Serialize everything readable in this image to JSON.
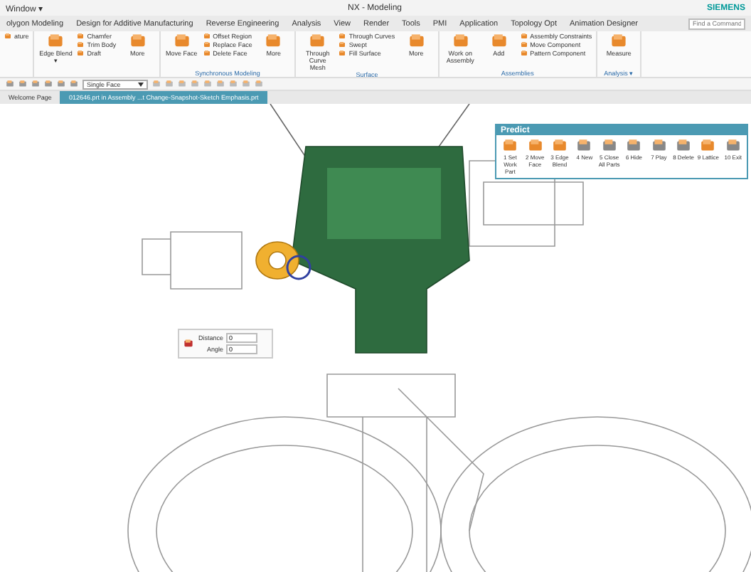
{
  "window": {
    "menu": "Window ▾",
    "title": "NX - Modeling",
    "brand": "SIEMENS"
  },
  "tabs": [
    {
      "label": "olygon Modeling",
      "selected": false
    },
    {
      "label": "Design for Additive Manufacturing",
      "selected": false
    },
    {
      "label": "Reverse Engineering",
      "selected": false
    },
    {
      "label": "Analysis",
      "selected": false
    },
    {
      "label": "View",
      "selected": false
    },
    {
      "label": "Render",
      "selected": false
    },
    {
      "label": "Tools",
      "selected": false
    },
    {
      "label": "PMI",
      "selected": false
    },
    {
      "label": "Application",
      "selected": false
    },
    {
      "label": "Topology Opt",
      "selected": false
    },
    {
      "label": "Animation Designer",
      "selected": false
    }
  ],
  "search": {
    "placeholder": "Find a Command"
  },
  "ribbon": [
    {
      "items": [
        {
          "kind": "small",
          "label": "ature"
        }
      ]
    },
    {
      "items": [
        {
          "kind": "large",
          "label": "Edge Blend ▾"
        },
        {
          "kind": "small",
          "label": "Chamfer"
        },
        {
          "kind": "small",
          "label": "Trim Body"
        },
        {
          "kind": "small",
          "label": "Draft"
        },
        {
          "kind": "large",
          "label": "More"
        }
      ]
    },
    {
      "label": "Synchronous Modeling",
      "items": [
        {
          "kind": "large",
          "label": "Move Face"
        },
        {
          "kind": "small",
          "label": "Offset Region"
        },
        {
          "kind": "small",
          "label": "Replace Face"
        },
        {
          "kind": "small",
          "label": "Delete Face"
        },
        {
          "kind": "large",
          "label": "More"
        }
      ]
    },
    {
      "label": "Surface",
      "items": [
        {
          "kind": "large",
          "label": "Through Curve Mesh"
        },
        {
          "kind": "small",
          "label": "Through Curves"
        },
        {
          "kind": "small",
          "label": "Swept"
        },
        {
          "kind": "small",
          "label": "Fill Surface"
        },
        {
          "kind": "large",
          "label": "More"
        }
      ]
    },
    {
      "label": "Assemblies",
      "items": [
        {
          "kind": "large",
          "label": "Work on Assembly"
        },
        {
          "kind": "large",
          "label": "Add"
        },
        {
          "kind": "small",
          "label": "Assembly Constraints"
        },
        {
          "kind": "small",
          "label": "Move Component"
        },
        {
          "kind": "small",
          "label": "Pattern Component"
        }
      ]
    },
    {
      "label": "Analysis ▾",
      "items": [
        {
          "kind": "large",
          "label": "Measure"
        }
      ]
    }
  ],
  "filter": {
    "value": "Single Face"
  },
  "documents": [
    {
      "label": "Welcome Page",
      "selected": false
    },
    {
      "label": "012646.prt in Assembly ...t Change-Snapshot-Sketch Emphasis.prt",
      "selected": true
    }
  ],
  "predict": {
    "title": "Predict",
    "items": [
      "1 Set Work Part",
      "2 Move Face",
      "3 Edge Blend",
      "4 New",
      "5 Close All Parts",
      "6 Hide",
      "7 Play",
      "8 Delete",
      "9 Lattice",
      "10 Exit"
    ]
  },
  "handle": {
    "fields": [
      {
        "label": "Distance",
        "value": "0"
      },
      {
        "label": "Angle",
        "value": "0"
      }
    ]
  }
}
